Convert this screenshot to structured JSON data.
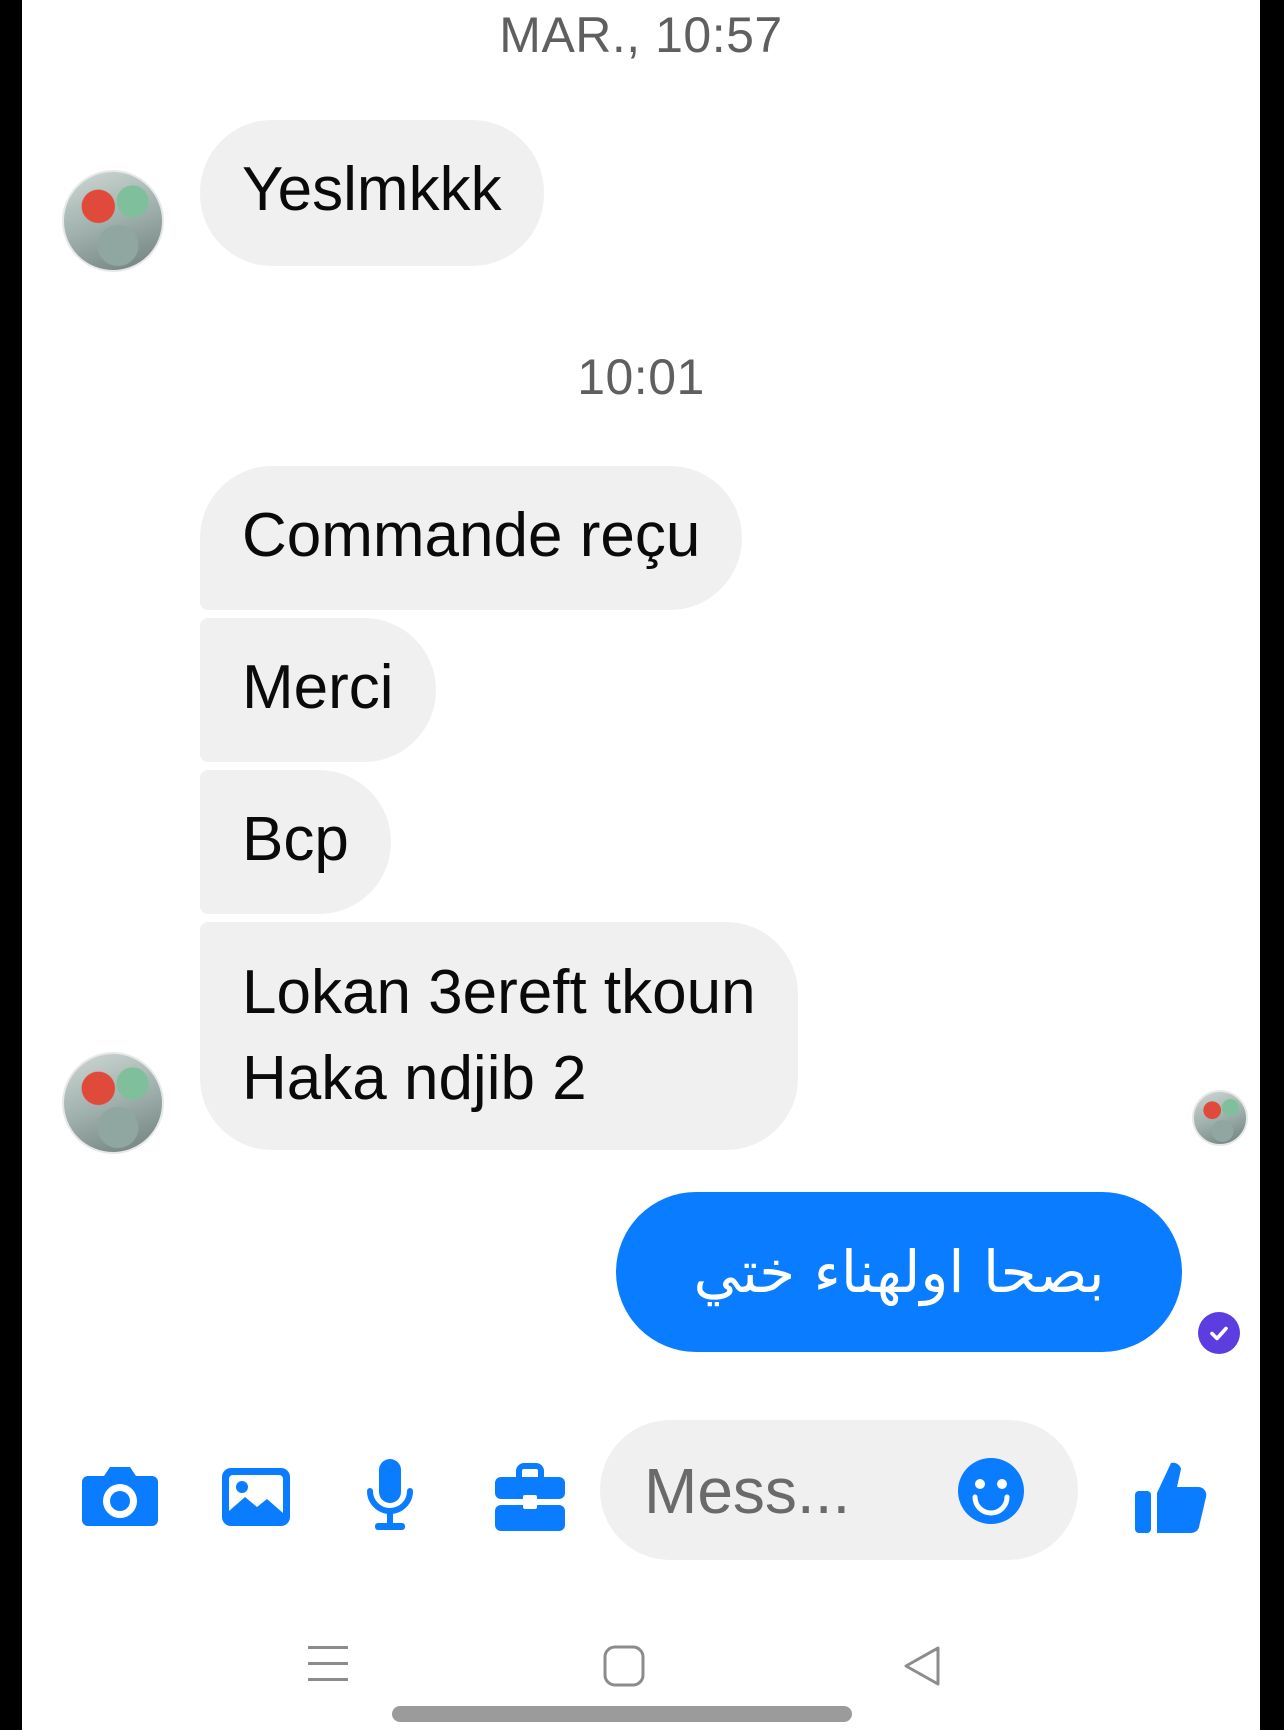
{
  "chat": {
    "timestamps": [
      "MAR., 10:57",
      "10:01"
    ],
    "incoming": [
      "Yeslmkkk",
      "Commande reçu",
      "Merci",
      "Bcp",
      "Lokan 3ereft tkoun",
      "Haka ndjib 2"
    ],
    "outgoing": [
      "بصحا اولهناء ختي"
    ]
  },
  "composer": {
    "placeholder": "Mess...",
    "icons": [
      "camera-icon",
      "image-icon",
      "microphone-icon",
      "toolbox-icon",
      "emoji-icon",
      "thumbs-up-icon"
    ]
  },
  "colors": {
    "accent": "#0a7cff",
    "incoming_bubble": "#f0f0f0",
    "seen": "#5b3de0"
  }
}
